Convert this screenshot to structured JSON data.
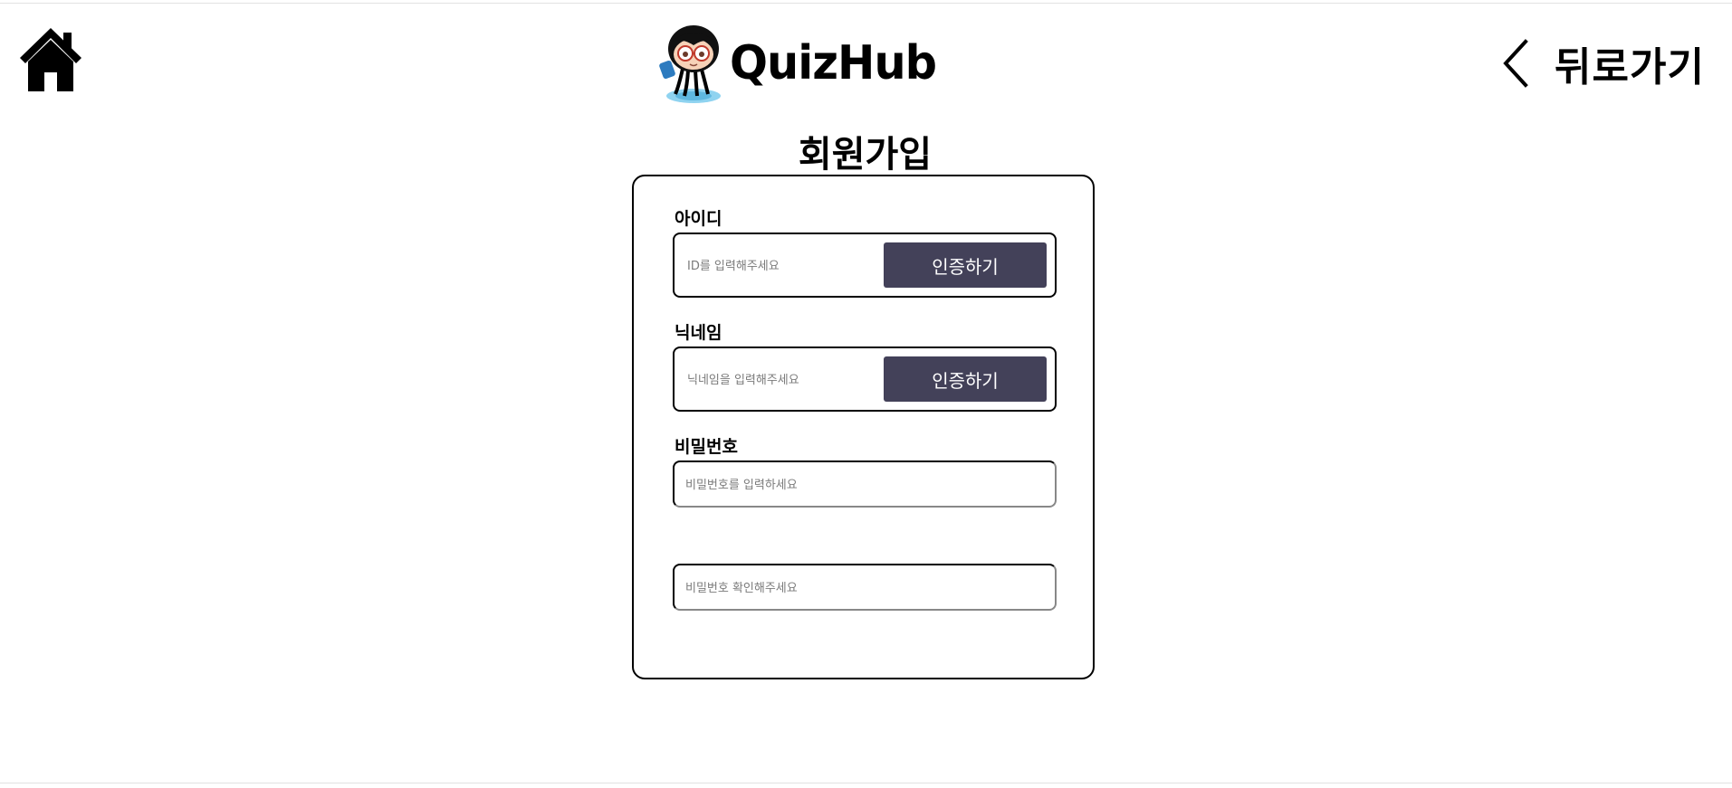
{
  "header": {
    "logo_text": "QuizHub",
    "back_label": "뒤로가기"
  },
  "page_title": "회원가입",
  "form": {
    "id": {
      "label": "아이디",
      "placeholder": "ID를 입력해주세요",
      "verify_label": "인증하기"
    },
    "nickname": {
      "label": "닉네임",
      "placeholder": "닉네임을 입력해주세요",
      "verify_label": "인증하기"
    },
    "password": {
      "label": "비밀번호",
      "placeholder": "비밀번호를 입력하세요"
    },
    "password_confirm": {
      "placeholder": "비밀번호 확인해주세요"
    }
  },
  "colors": {
    "button_bg": "#434159",
    "button_text": "#ffffff"
  },
  "icons": {
    "home": "home-icon",
    "back": "chevron-left-icon",
    "mascot": "octopus-mascot-logo"
  }
}
